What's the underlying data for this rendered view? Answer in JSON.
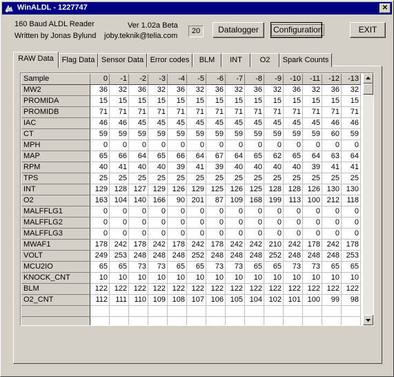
{
  "window": {
    "title": "WinALDL - 1227747",
    "close_label": "✕"
  },
  "header": {
    "line1": "160 Baud ALDL Reader",
    "line2": "Written by Jonas Bylund",
    "version": "Ver 1.02a Beta",
    "email": "joby.teknik@telia.com",
    "counter": "20"
  },
  "buttons": {
    "datalogger": "Datalogger",
    "configuration": "Configuration",
    "exit": "EXIT"
  },
  "tabs": [
    {
      "label": "RAW Data"
    },
    {
      "label": "Flag Data"
    },
    {
      "label": "Sensor Data"
    },
    {
      "label": "Error codes"
    },
    {
      "label": "BLM"
    },
    {
      "label": "INT"
    },
    {
      "label": "O2"
    },
    {
      "label": "Spark Counts"
    }
  ],
  "grid": {
    "columns": [
      "Sample",
      "0",
      "-1",
      "-2",
      "-3",
      "-4",
      "-5",
      "-6",
      "-7",
      "-8",
      "-9",
      "-10",
      "-11",
      "-12",
      "-13"
    ],
    "rows": [
      {
        "name": "MW2",
        "values": [
          "36",
          "32",
          "36",
          "32",
          "36",
          "32",
          "36",
          "32",
          "36",
          "32",
          "36",
          "32",
          "36",
          "32"
        ]
      },
      {
        "name": "PROMIDA",
        "values": [
          "15",
          "15",
          "15",
          "15",
          "15",
          "15",
          "15",
          "15",
          "15",
          "15",
          "15",
          "15",
          "15",
          "15"
        ]
      },
      {
        "name": "PROMIDB",
        "values": [
          "71",
          "71",
          "71",
          "71",
          "71",
          "71",
          "71",
          "71",
          "71",
          "71",
          "71",
          "71",
          "71",
          "71"
        ]
      },
      {
        "name": "IAC",
        "values": [
          "46",
          "46",
          "45",
          "45",
          "45",
          "45",
          "45",
          "45",
          "45",
          "45",
          "45",
          "45",
          "46",
          "46"
        ]
      },
      {
        "name": "CT",
        "values": [
          "59",
          "59",
          "59",
          "59",
          "59",
          "59",
          "59",
          "59",
          "59",
          "59",
          "59",
          "59",
          "60",
          "59"
        ]
      },
      {
        "name": "MPH",
        "values": [
          "0",
          "0",
          "0",
          "0",
          "0",
          "0",
          "0",
          "0",
          "0",
          "0",
          "0",
          "0",
          "0",
          "0"
        ]
      },
      {
        "name": "MAP",
        "values": [
          "65",
          "66",
          "64",
          "65",
          "66",
          "64",
          "67",
          "64",
          "65",
          "62",
          "65",
          "64",
          "63",
          "64"
        ]
      },
      {
        "name": "RPM",
        "values": [
          "40",
          "41",
          "40",
          "40",
          "39",
          "41",
          "39",
          "40",
          "40",
          "40",
          "40",
          "39",
          "41",
          "41"
        ]
      },
      {
        "name": "TPS",
        "values": [
          "25",
          "25",
          "25",
          "25",
          "25",
          "25",
          "25",
          "25",
          "25",
          "25",
          "25",
          "25",
          "25",
          "25"
        ]
      },
      {
        "name": "INT",
        "values": [
          "129",
          "128",
          "127",
          "129",
          "126",
          "129",
          "125",
          "126",
          "125",
          "128",
          "128",
          "126",
          "130",
          "130"
        ]
      },
      {
        "name": "O2",
        "values": [
          "163",
          "104",
          "140",
          "166",
          "90",
          "201",
          "87",
          "109",
          "168",
          "199",
          "113",
          "100",
          "212",
          "118"
        ]
      },
      {
        "name": "MALFFLG1",
        "values": [
          "0",
          "0",
          "0",
          "0",
          "0",
          "0",
          "0",
          "0",
          "0",
          "0",
          "0",
          "0",
          "0",
          "0"
        ]
      },
      {
        "name": "MALFFLG2",
        "values": [
          "0",
          "0",
          "0",
          "0",
          "0",
          "0",
          "0",
          "0",
          "0",
          "0",
          "0",
          "0",
          "0",
          "0"
        ]
      },
      {
        "name": "MALFFLG3",
        "values": [
          "0",
          "0",
          "0",
          "0",
          "0",
          "0",
          "0",
          "0",
          "0",
          "0",
          "0",
          "0",
          "0",
          "0"
        ]
      },
      {
        "name": "MWAF1",
        "values": [
          "178",
          "242",
          "178",
          "242",
          "178",
          "242",
          "178",
          "242",
          "242",
          "210",
          "242",
          "178",
          "242",
          "178"
        ]
      },
      {
        "name": "VOLT",
        "values": [
          "249",
          "253",
          "248",
          "248",
          "248",
          "252",
          "248",
          "248",
          "248",
          "252",
          "248",
          "248",
          "248",
          "253"
        ]
      },
      {
        "name": "MCU2IO",
        "values": [
          "65",
          "65",
          "73",
          "73",
          "65",
          "65",
          "73",
          "73",
          "65",
          "65",
          "73",
          "73",
          "65",
          "65"
        ]
      },
      {
        "name": "KNOCK_CNT",
        "values": [
          "10",
          "10",
          "10",
          "10",
          "10",
          "10",
          "10",
          "10",
          "10",
          "10",
          "10",
          "10",
          "10",
          "10"
        ]
      },
      {
        "name": "BLM",
        "values": [
          "122",
          "122",
          "122",
          "122",
          "122",
          "122",
          "122",
          "122",
          "122",
          "122",
          "122",
          "122",
          "122",
          "122"
        ]
      },
      {
        "name": "O2_CNT",
        "values": [
          "112",
          "111",
          "110",
          "109",
          "108",
          "107",
          "106",
          "105",
          "104",
          "102",
          "101",
          "100",
          "99",
          "98"
        ]
      },
      {
        "name": "",
        "values": [
          "",
          "",
          "",
          "",
          "",
          "",
          "",
          "",
          "",
          "",
          "",
          "",
          "",
          ""
        ]
      },
      {
        "name": "",
        "values": [
          "",
          "",
          "",
          "",
          "",
          "",
          "",
          "",
          "",
          "",
          "",
          "",
          "",
          ""
        ]
      }
    ]
  },
  "scrollbar": {
    "up_icon": "scroll-up-arrow",
    "down_icon": "scroll-down-arrow"
  }
}
